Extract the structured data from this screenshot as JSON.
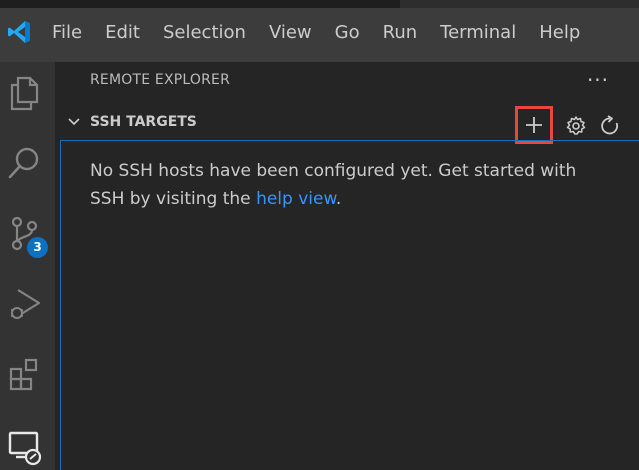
{
  "menu": {
    "items": [
      "File",
      "Edit",
      "Selection",
      "View",
      "Go",
      "Run",
      "Terminal",
      "Help"
    ]
  },
  "activity_bar": {
    "items": [
      {
        "name": "explorer",
        "icon": "files-icon"
      },
      {
        "name": "search",
        "icon": "search-icon"
      },
      {
        "name": "source-control",
        "icon": "source-control-icon",
        "badge": "3"
      },
      {
        "name": "run-and-debug",
        "icon": "run-debug-icon"
      },
      {
        "name": "extensions",
        "icon": "extensions-icon"
      },
      {
        "name": "remote-explorer",
        "icon": "remote-explorer-icon"
      }
    ]
  },
  "sidebar": {
    "title": "REMOTE EXPLORER",
    "more_icon": "ellipsis-icon",
    "section": {
      "title": "SSH TARGETS",
      "actions": [
        "add-icon",
        "gear-icon",
        "refresh-icon"
      ]
    },
    "message": {
      "before_link": "No SSH hosts have been configured yet. Get started with SSH by visiting the ",
      "link_text": "help view",
      "after_link": "."
    }
  },
  "colors": {
    "titlebar": "#3c3c3c",
    "activitybar": "#333333",
    "sidebar": "#252526",
    "focus_border": "#0e70c0",
    "badge": "#0e70c0",
    "link": "#3794ff",
    "highlight_box": "#e8473e"
  }
}
